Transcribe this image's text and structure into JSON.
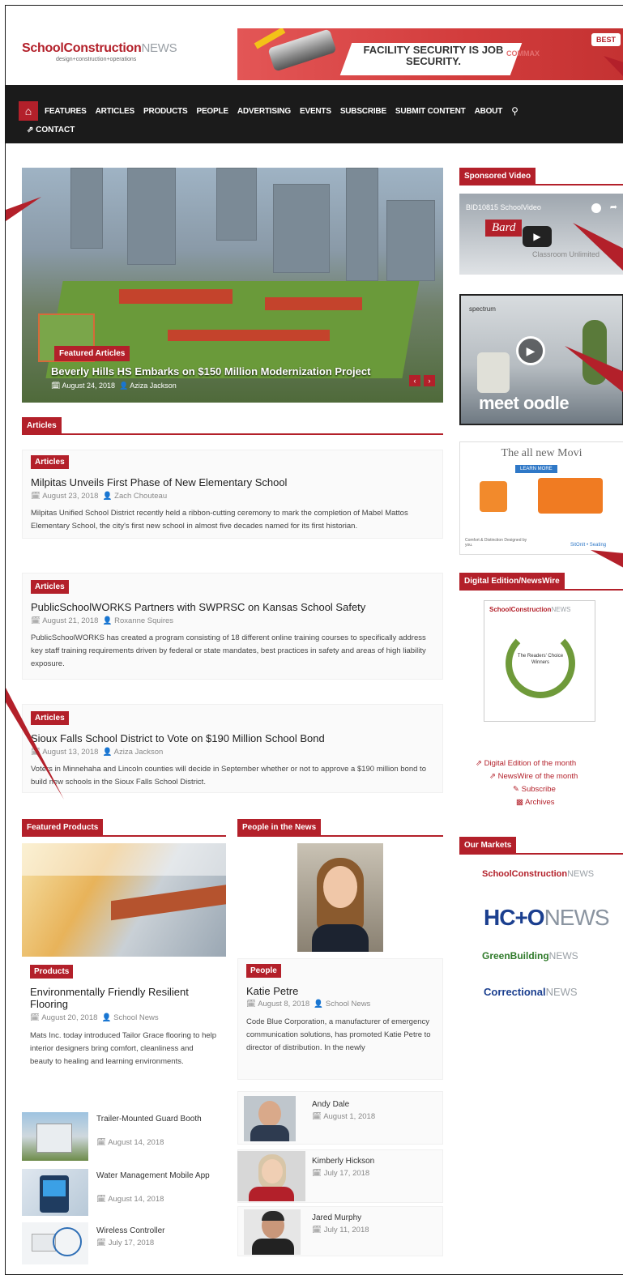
{
  "brand": {
    "name_a": "SchoolConstruction",
    "name_b": "NEWS",
    "tagline": "design+construction+operations"
  },
  "banner": {
    "headline": "FACILITY SECURITY IS JOB SECURITY.",
    "sponsor": "COMMAX",
    "badge": "BEST"
  },
  "nav": {
    "items": [
      "FEATURES",
      "ARTICLES",
      "PRODUCTS",
      "PEOPLE",
      "ADVERTISING",
      "EVENTS",
      "SUBSCRIBE",
      "SUBMIT CONTENT",
      "ABOUT"
    ],
    "contact": "CONTACT"
  },
  "hero": {
    "tag": "Featured Articles",
    "title": "Beverly Hills HS Embarks on $150 Million Modernization Project",
    "date": "August 24, 2018",
    "author": "Aziza Jackson"
  },
  "articles_section": "Articles",
  "articles": [
    {
      "badge": "Articles",
      "title": "Milpitas Unveils First Phase of New Elementary School",
      "date": "August 23, 2018",
      "author": "Zach Chouteau",
      "excerpt": "Milpitas Unified School District recently held a ribbon-cutting ceremony to mark the completion of Mabel Mattos Elementary School, the city's first new school in almost five decades named for its first historian."
    },
    {
      "badge": "Articles",
      "title": "PublicSchoolWORKS Partners with SWPRSC on Kansas School Safety",
      "date": "August 21, 2018",
      "author": "Roxanne Squires",
      "excerpt": "PublicSchoolWORKS has created a program consisting of 18 different online training courses to specifically address key staff training requirements driven by federal or state mandates, best practices in safety and areas of high liability exposure."
    },
    {
      "badge": "Articles",
      "title": "Sioux Falls School District to Vote on $190 Million School Bond",
      "date": "August 13, 2018",
      "author": "Aziza Jackson",
      "excerpt": "Voters in Minnehaha and Lincoln counties will decide in September whether or not to approve a $190 million bond to build new schools in the Sioux Falls School District."
    }
  ],
  "products_section": "Featured Products",
  "featured_product": {
    "badge": "Products",
    "title": "Environmentally Friendly Resilient Flooring",
    "date": "August 20, 2018",
    "author": "School News",
    "excerpt": "Mats Inc. today introduced Tailor Grace flooring to help interior designers bring comfort, cleanliness and beauty to healing and learning environments."
  },
  "products": [
    {
      "title": "Trailer-Mounted Guard Booth",
      "date": "August 14, 2018"
    },
    {
      "title": "Water Management Mobile App",
      "date": "August 14, 2018"
    },
    {
      "title": "Wireless Controller",
      "date": "July 17, 2018"
    }
  ],
  "people_section": "People in the News",
  "featured_person": {
    "badge": "People",
    "title": "Katie Petre",
    "date": "August 8, 2018",
    "author": "School News",
    "excerpt": "Code Blue Corporation, a manufacturer of emergency communication solutions, has promoted Katie Petre to director of distribution. In the newly"
  },
  "people": [
    {
      "name": "Andy Dale",
      "date": "August 1, 2018"
    },
    {
      "name": "Kimberly Hickson",
      "date": "July 17, 2018"
    },
    {
      "name": "Jared Murphy",
      "date": "July 11, 2018"
    }
  ],
  "sidebar": {
    "sponsored_video": "Sponsored Video",
    "video_title": "BID10815 SchoolVideo",
    "video_brand": "Bard",
    "video_sub": "Classroom Unlimited",
    "oodle_text": "meet oodle",
    "oodle_brand": "spectrum",
    "movi_headline": "The all new Movi",
    "movi_button": "LEARN MORE",
    "movi_foot_left": "Comfort & Distinction Designed by you.",
    "movi_foot_right": "SitOnIt • Seating",
    "digital_section": "Digital Edition/NewsWire",
    "award_title": "The Readers' Choice Winners",
    "links": [
      "Digital Edition of the month",
      "NewsWire of the month",
      "Subscribe",
      "Archives"
    ],
    "markets_section": "Our Markets",
    "markets": [
      {
        "a": "SchoolConstruction",
        "b": "NEWS"
      },
      {
        "a": "HC+O",
        "b": "NEWS"
      },
      {
        "a": "GreenBuilding",
        "b": "NEWS"
      },
      {
        "a": "Correctional",
        "b": "NEWS"
      }
    ]
  },
  "colors": {
    "accent": "#b3202a",
    "nav": "#1b1b1b"
  }
}
